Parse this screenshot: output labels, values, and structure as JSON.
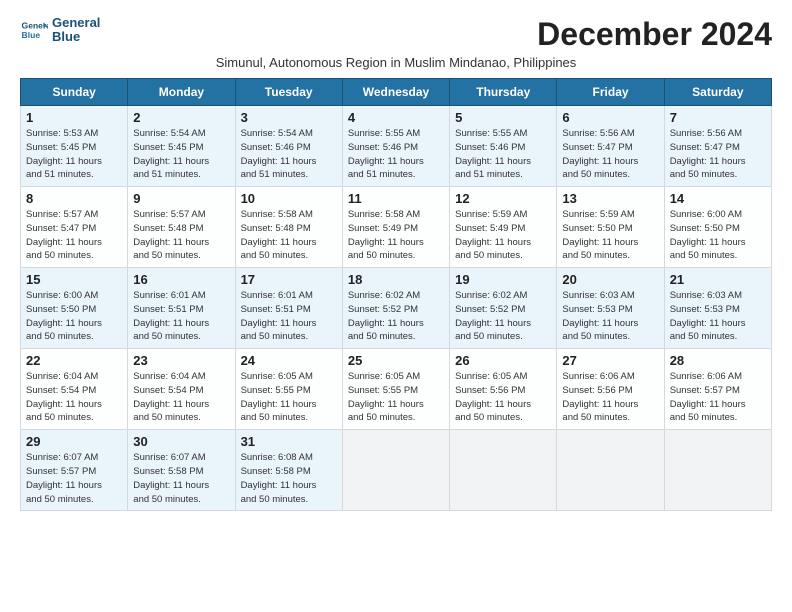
{
  "logo": {
    "line1": "General",
    "line2": "Blue"
  },
  "title": "December 2024",
  "subtitle": "Simunul, Autonomous Region in Muslim Mindanao, Philippines",
  "days_of_week": [
    "Sunday",
    "Monday",
    "Tuesday",
    "Wednesday",
    "Thursday",
    "Friday",
    "Saturday"
  ],
  "weeks": [
    [
      {
        "day": "1",
        "detail": "Sunrise: 5:53 AM\nSunset: 5:45 PM\nDaylight: 11 hours\nand 51 minutes."
      },
      {
        "day": "2",
        "detail": "Sunrise: 5:54 AM\nSunset: 5:45 PM\nDaylight: 11 hours\nand 51 minutes."
      },
      {
        "day": "3",
        "detail": "Sunrise: 5:54 AM\nSunset: 5:46 PM\nDaylight: 11 hours\nand 51 minutes."
      },
      {
        "day": "4",
        "detail": "Sunrise: 5:55 AM\nSunset: 5:46 PM\nDaylight: 11 hours\nand 51 minutes."
      },
      {
        "day": "5",
        "detail": "Sunrise: 5:55 AM\nSunset: 5:46 PM\nDaylight: 11 hours\nand 51 minutes."
      },
      {
        "day": "6",
        "detail": "Sunrise: 5:56 AM\nSunset: 5:47 PM\nDaylight: 11 hours\nand 50 minutes."
      },
      {
        "day": "7",
        "detail": "Sunrise: 5:56 AM\nSunset: 5:47 PM\nDaylight: 11 hours\nand 50 minutes."
      }
    ],
    [
      {
        "day": "8",
        "detail": "Sunrise: 5:57 AM\nSunset: 5:47 PM\nDaylight: 11 hours\nand 50 minutes."
      },
      {
        "day": "9",
        "detail": "Sunrise: 5:57 AM\nSunset: 5:48 PM\nDaylight: 11 hours\nand 50 minutes."
      },
      {
        "day": "10",
        "detail": "Sunrise: 5:58 AM\nSunset: 5:48 PM\nDaylight: 11 hours\nand 50 minutes."
      },
      {
        "day": "11",
        "detail": "Sunrise: 5:58 AM\nSunset: 5:49 PM\nDaylight: 11 hours\nand 50 minutes."
      },
      {
        "day": "12",
        "detail": "Sunrise: 5:59 AM\nSunset: 5:49 PM\nDaylight: 11 hours\nand 50 minutes."
      },
      {
        "day": "13",
        "detail": "Sunrise: 5:59 AM\nSunset: 5:50 PM\nDaylight: 11 hours\nand 50 minutes."
      },
      {
        "day": "14",
        "detail": "Sunrise: 6:00 AM\nSunset: 5:50 PM\nDaylight: 11 hours\nand 50 minutes."
      }
    ],
    [
      {
        "day": "15",
        "detail": "Sunrise: 6:00 AM\nSunset: 5:50 PM\nDaylight: 11 hours\nand 50 minutes."
      },
      {
        "day": "16",
        "detail": "Sunrise: 6:01 AM\nSunset: 5:51 PM\nDaylight: 11 hours\nand 50 minutes."
      },
      {
        "day": "17",
        "detail": "Sunrise: 6:01 AM\nSunset: 5:51 PM\nDaylight: 11 hours\nand 50 minutes."
      },
      {
        "day": "18",
        "detail": "Sunrise: 6:02 AM\nSunset: 5:52 PM\nDaylight: 11 hours\nand 50 minutes."
      },
      {
        "day": "19",
        "detail": "Sunrise: 6:02 AM\nSunset: 5:52 PM\nDaylight: 11 hours\nand 50 minutes."
      },
      {
        "day": "20",
        "detail": "Sunrise: 6:03 AM\nSunset: 5:53 PM\nDaylight: 11 hours\nand 50 minutes."
      },
      {
        "day": "21",
        "detail": "Sunrise: 6:03 AM\nSunset: 5:53 PM\nDaylight: 11 hours\nand 50 minutes."
      }
    ],
    [
      {
        "day": "22",
        "detail": "Sunrise: 6:04 AM\nSunset: 5:54 PM\nDaylight: 11 hours\nand 50 minutes."
      },
      {
        "day": "23",
        "detail": "Sunrise: 6:04 AM\nSunset: 5:54 PM\nDaylight: 11 hours\nand 50 minutes."
      },
      {
        "day": "24",
        "detail": "Sunrise: 6:05 AM\nSunset: 5:55 PM\nDaylight: 11 hours\nand 50 minutes."
      },
      {
        "day": "25",
        "detail": "Sunrise: 6:05 AM\nSunset: 5:55 PM\nDaylight: 11 hours\nand 50 minutes."
      },
      {
        "day": "26",
        "detail": "Sunrise: 6:05 AM\nSunset: 5:56 PM\nDaylight: 11 hours\nand 50 minutes."
      },
      {
        "day": "27",
        "detail": "Sunrise: 6:06 AM\nSunset: 5:56 PM\nDaylight: 11 hours\nand 50 minutes."
      },
      {
        "day": "28",
        "detail": "Sunrise: 6:06 AM\nSunset: 5:57 PM\nDaylight: 11 hours\nand 50 minutes."
      }
    ],
    [
      {
        "day": "29",
        "detail": "Sunrise: 6:07 AM\nSunset: 5:57 PM\nDaylight: 11 hours\nand 50 minutes."
      },
      {
        "day": "30",
        "detail": "Sunrise: 6:07 AM\nSunset: 5:58 PM\nDaylight: 11 hours\nand 50 minutes."
      },
      {
        "day": "31",
        "detail": "Sunrise: 6:08 AM\nSunset: 5:58 PM\nDaylight: 11 hours\nand 50 minutes."
      },
      {
        "day": "",
        "detail": ""
      },
      {
        "day": "",
        "detail": ""
      },
      {
        "day": "",
        "detail": ""
      },
      {
        "day": "",
        "detail": ""
      }
    ]
  ]
}
